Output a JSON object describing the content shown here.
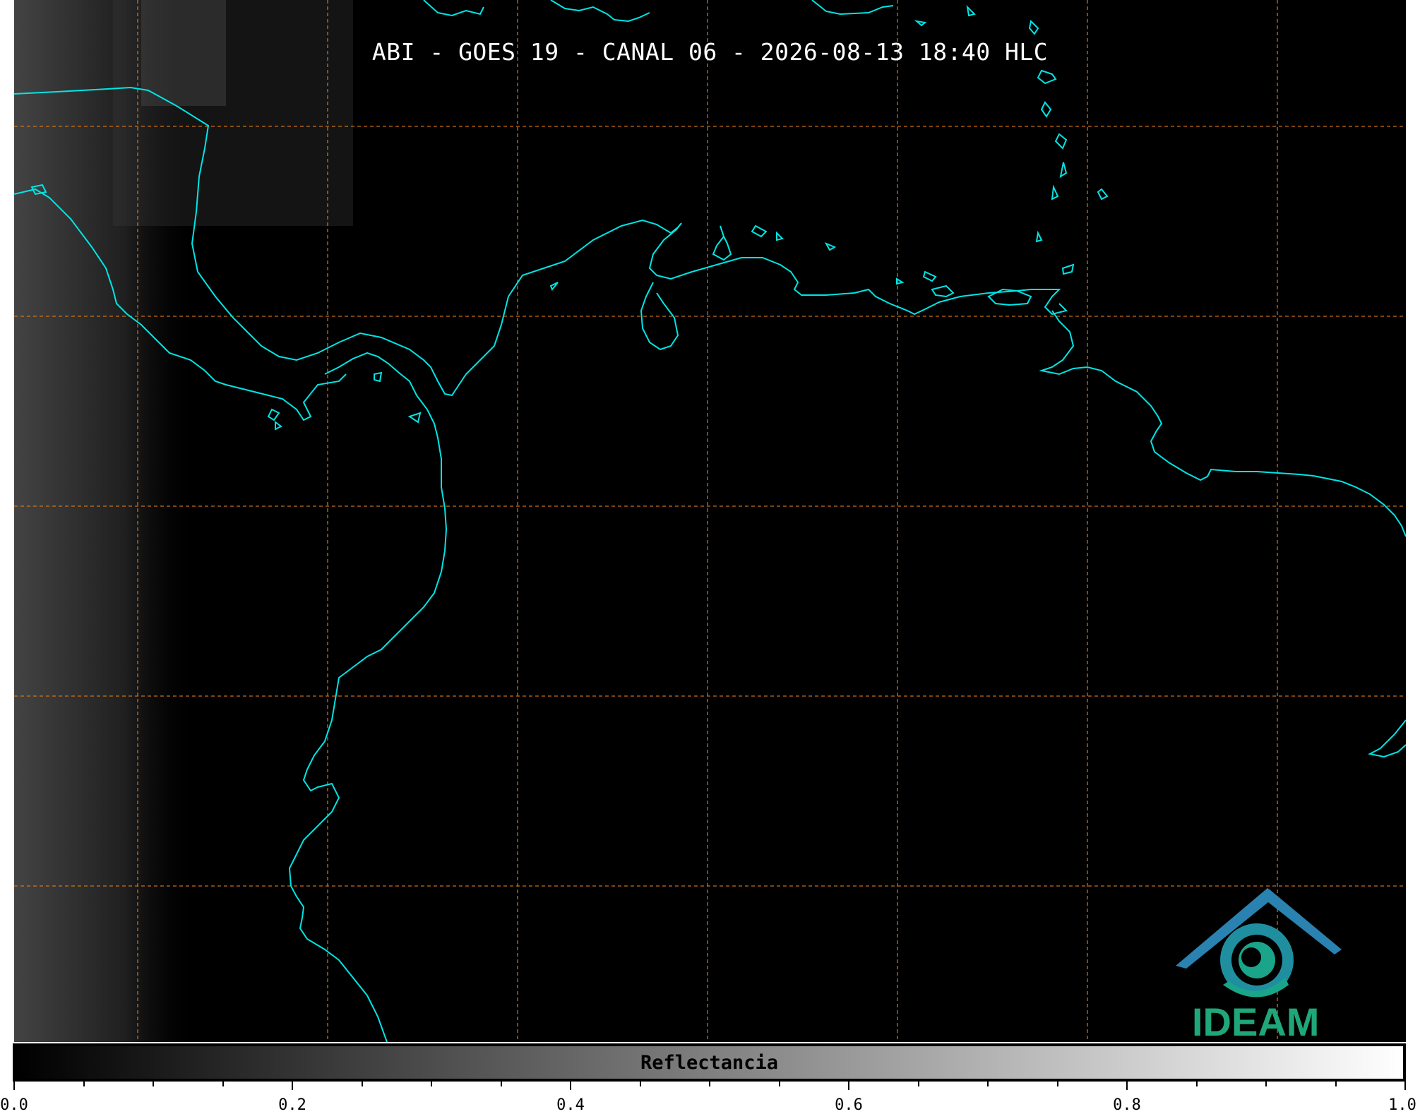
{
  "title": "ABI - GOES 19 - CANAL 06 - 2026-08-13 18:40 HLC",
  "colorbar": {
    "label": "Reflectancia",
    "ticks": [
      "0.0",
      "0.2",
      "0.4",
      "0.6",
      "0.8",
      "1.0"
    ],
    "range": [
      0.0,
      1.0
    ]
  },
  "logo": {
    "text": "IDEAM"
  },
  "colors": {
    "coastline": "#00e5e5",
    "grid": "#e07b1a",
    "background": "#000000",
    "logo": "#1fa779"
  }
}
